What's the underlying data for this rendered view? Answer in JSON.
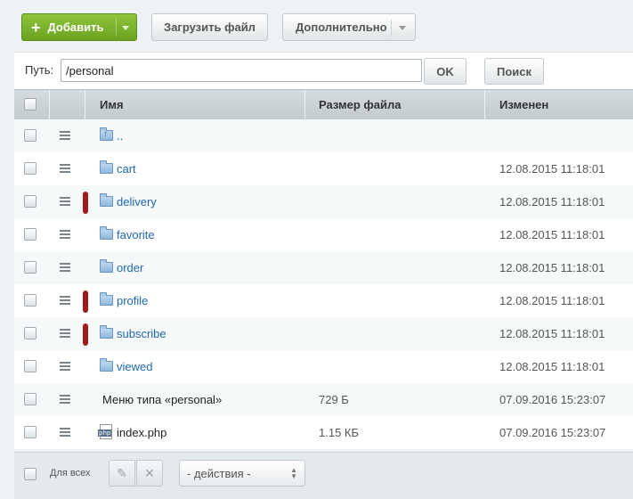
{
  "toolbar": {
    "add_label": "Добавить",
    "upload_label": "Загрузить файл",
    "more_label": "Дополнительно"
  },
  "path": {
    "label": "Путь:",
    "value": "/personal",
    "ok_label": "OK",
    "search_label": "Поиск"
  },
  "columns": {
    "name": "Имя",
    "size": "Размер файла",
    "modified": "Изменен"
  },
  "rows": [
    {
      "name": "..",
      "size": "",
      "modified": "",
      "type": "up"
    },
    {
      "name": "cart",
      "size": "",
      "modified": "12.08.2015 11:18:01",
      "type": "folder",
      "marked": false
    },
    {
      "name": "delivery",
      "size": "",
      "modified": "12.08.2015 11:18:01",
      "type": "folder",
      "marked": true
    },
    {
      "name": "favorite",
      "size": "",
      "modified": "12.08.2015 11:18:01",
      "type": "folder",
      "marked": false
    },
    {
      "name": "order",
      "size": "",
      "modified": "12.08.2015 11:18:01",
      "type": "folder",
      "marked": false
    },
    {
      "name": "profile",
      "size": "",
      "modified": "12.08.2015 11:18:01",
      "type": "folder",
      "marked": true
    },
    {
      "name": "subscribe",
      "size": "",
      "modified": "12.08.2015 11:18:01",
      "type": "folder",
      "marked": true
    },
    {
      "name": "viewed",
      "size": "",
      "modified": "12.08.2015 11:18:01",
      "type": "folder",
      "marked": false
    },
    {
      "name": "Меню типа «personal»",
      "size": "729 Б",
      "modified": "07.09.2016 15:23:07",
      "type": "menu"
    },
    {
      "name": "index.php",
      "size": "1.15 КБ",
      "modified": "07.09.2016 15:23:07",
      "type": "php"
    }
  ],
  "footer": {
    "for_all_label": "Для всех",
    "actions_value": "- действия -"
  },
  "colors": {
    "add_button": "#7ab32e",
    "marker": "#a01c1c",
    "link": "#2067b0"
  },
  "icons": {
    "add": "plus-icon",
    "folder": "folder-icon",
    "folder_up": "folder-up-icon",
    "php_file": "php-file-icon",
    "row_menu": "hamburger-icon",
    "edit": "pencil-icon",
    "delete": "close-icon"
  }
}
